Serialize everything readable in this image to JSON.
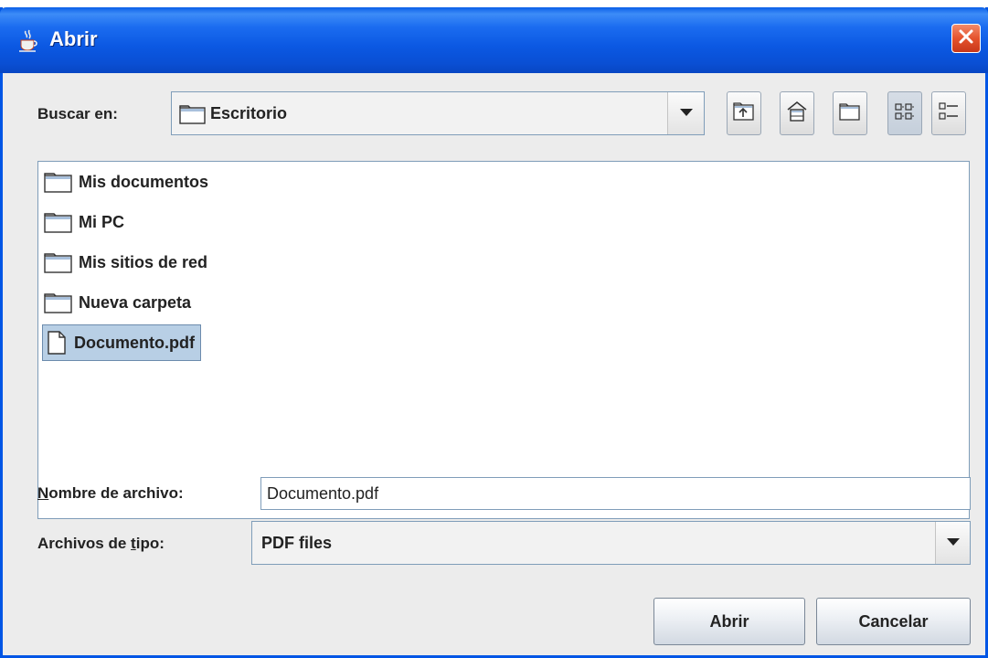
{
  "window": {
    "title": "Abrir"
  },
  "lookin": {
    "label": "Buscar en:",
    "value": "Escritorio"
  },
  "files": [
    {
      "name": "Mis documentos",
      "type": "folder"
    },
    {
      "name": "Mi PC",
      "type": "folder"
    },
    {
      "name": "Mis sitios de red",
      "type": "folder"
    },
    {
      "name": "Nueva carpeta",
      "type": "folder"
    },
    {
      "name": "Documento.pdf",
      "type": "file",
      "selected": true
    }
  ],
  "filename": {
    "label_prefix": "N",
    "label_rest": "ombre de archivo:",
    "value": "Documento.pdf"
  },
  "filetype": {
    "label_prefix": "Archivos de ",
    "label_mnemonic": "t",
    "label_rest": "ipo:",
    "value": "PDF files"
  },
  "buttons": {
    "open": "Abrir",
    "cancel": "Cancelar"
  },
  "icons": {
    "window": "java-cup-icon",
    "close": "close-icon",
    "up": "up-folder-icon",
    "home": "home-icon",
    "new_folder": "new-folder-icon",
    "list_view": "list-view-icon",
    "details_view": "details-view-icon",
    "folder": "folder-icon",
    "file": "file-icon",
    "dropdown": "chevron-down-icon"
  },
  "colors": {
    "titlebar": "#0b58e2",
    "selection": "#b8cfe5",
    "close_button": "#e5532d"
  }
}
